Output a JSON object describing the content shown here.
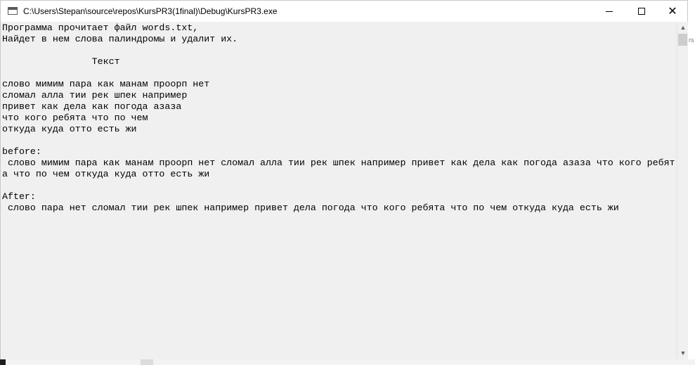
{
  "window": {
    "title": "C:\\Users\\Stepan\\source\\repos\\KursPR3(1final)\\Debug\\KursPR3.exe",
    "controls": {
      "minimize": "",
      "maximize": "",
      "close": "✕"
    }
  },
  "console": {
    "text": "Программа прочитает файл words.txt,\nНайдет в нем слова палиндромы и удалит их.\n\n                Текст\n\nслово мимим пара как манам проорп нет\nсломал алла тии рек шпек например\nпривет как дела как погода азаза\nчто кого ребята что по чем\nоткуда куда отто есть жи\n\nbefore:\n слово мимим пара как манам проорп нет сломал алла тии рек шпек например привет как дела как погода азаза что кого ребят\nа что по чем откуда куда отто есть жи\n\nAfter:\n слово пара нет сломал тии рек шпек например привет дела погода что кого ребята что по чем откуда куда есть жи"
  },
  "scrollbar": {
    "up_arrow": "▲",
    "down_arrow": "▼"
  },
  "background": {
    "partial_text": "rs"
  }
}
